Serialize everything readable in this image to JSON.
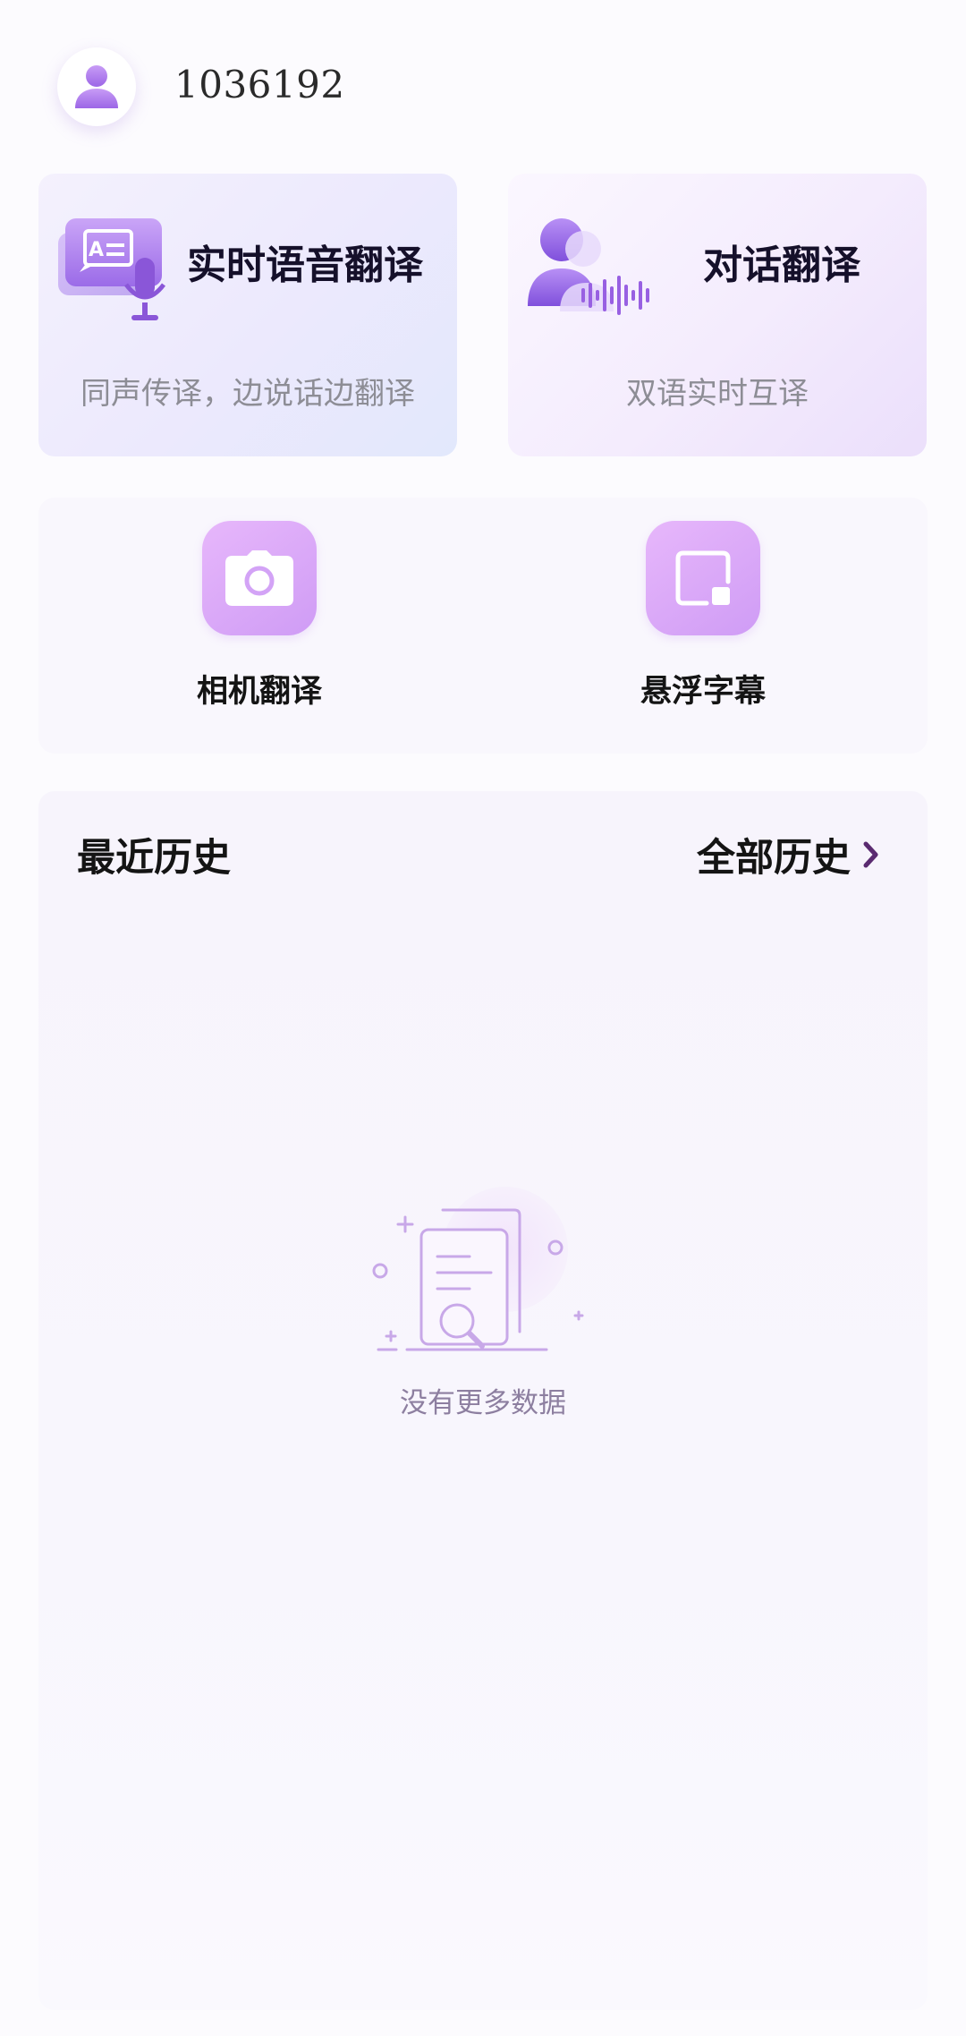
{
  "header": {
    "user_id": "1036192"
  },
  "feature_cards": [
    {
      "title": "实时语音翻译",
      "subtitle": "同声传译，边说话边翻译"
    },
    {
      "title": "对话翻译",
      "subtitle": "双语实时互译"
    }
  ],
  "tools": [
    {
      "label": "相机翻译",
      "icon": "camera-icon"
    },
    {
      "label": "悬浮字幕",
      "icon": "floating-window-icon"
    }
  ],
  "history": {
    "title": "最近历史",
    "all_label": "全部历史",
    "empty_text": "没有更多数据"
  },
  "colors": {
    "accent": "#c896f3",
    "accent_dark": "#8a56d8",
    "chevron": "#5a2a70"
  }
}
